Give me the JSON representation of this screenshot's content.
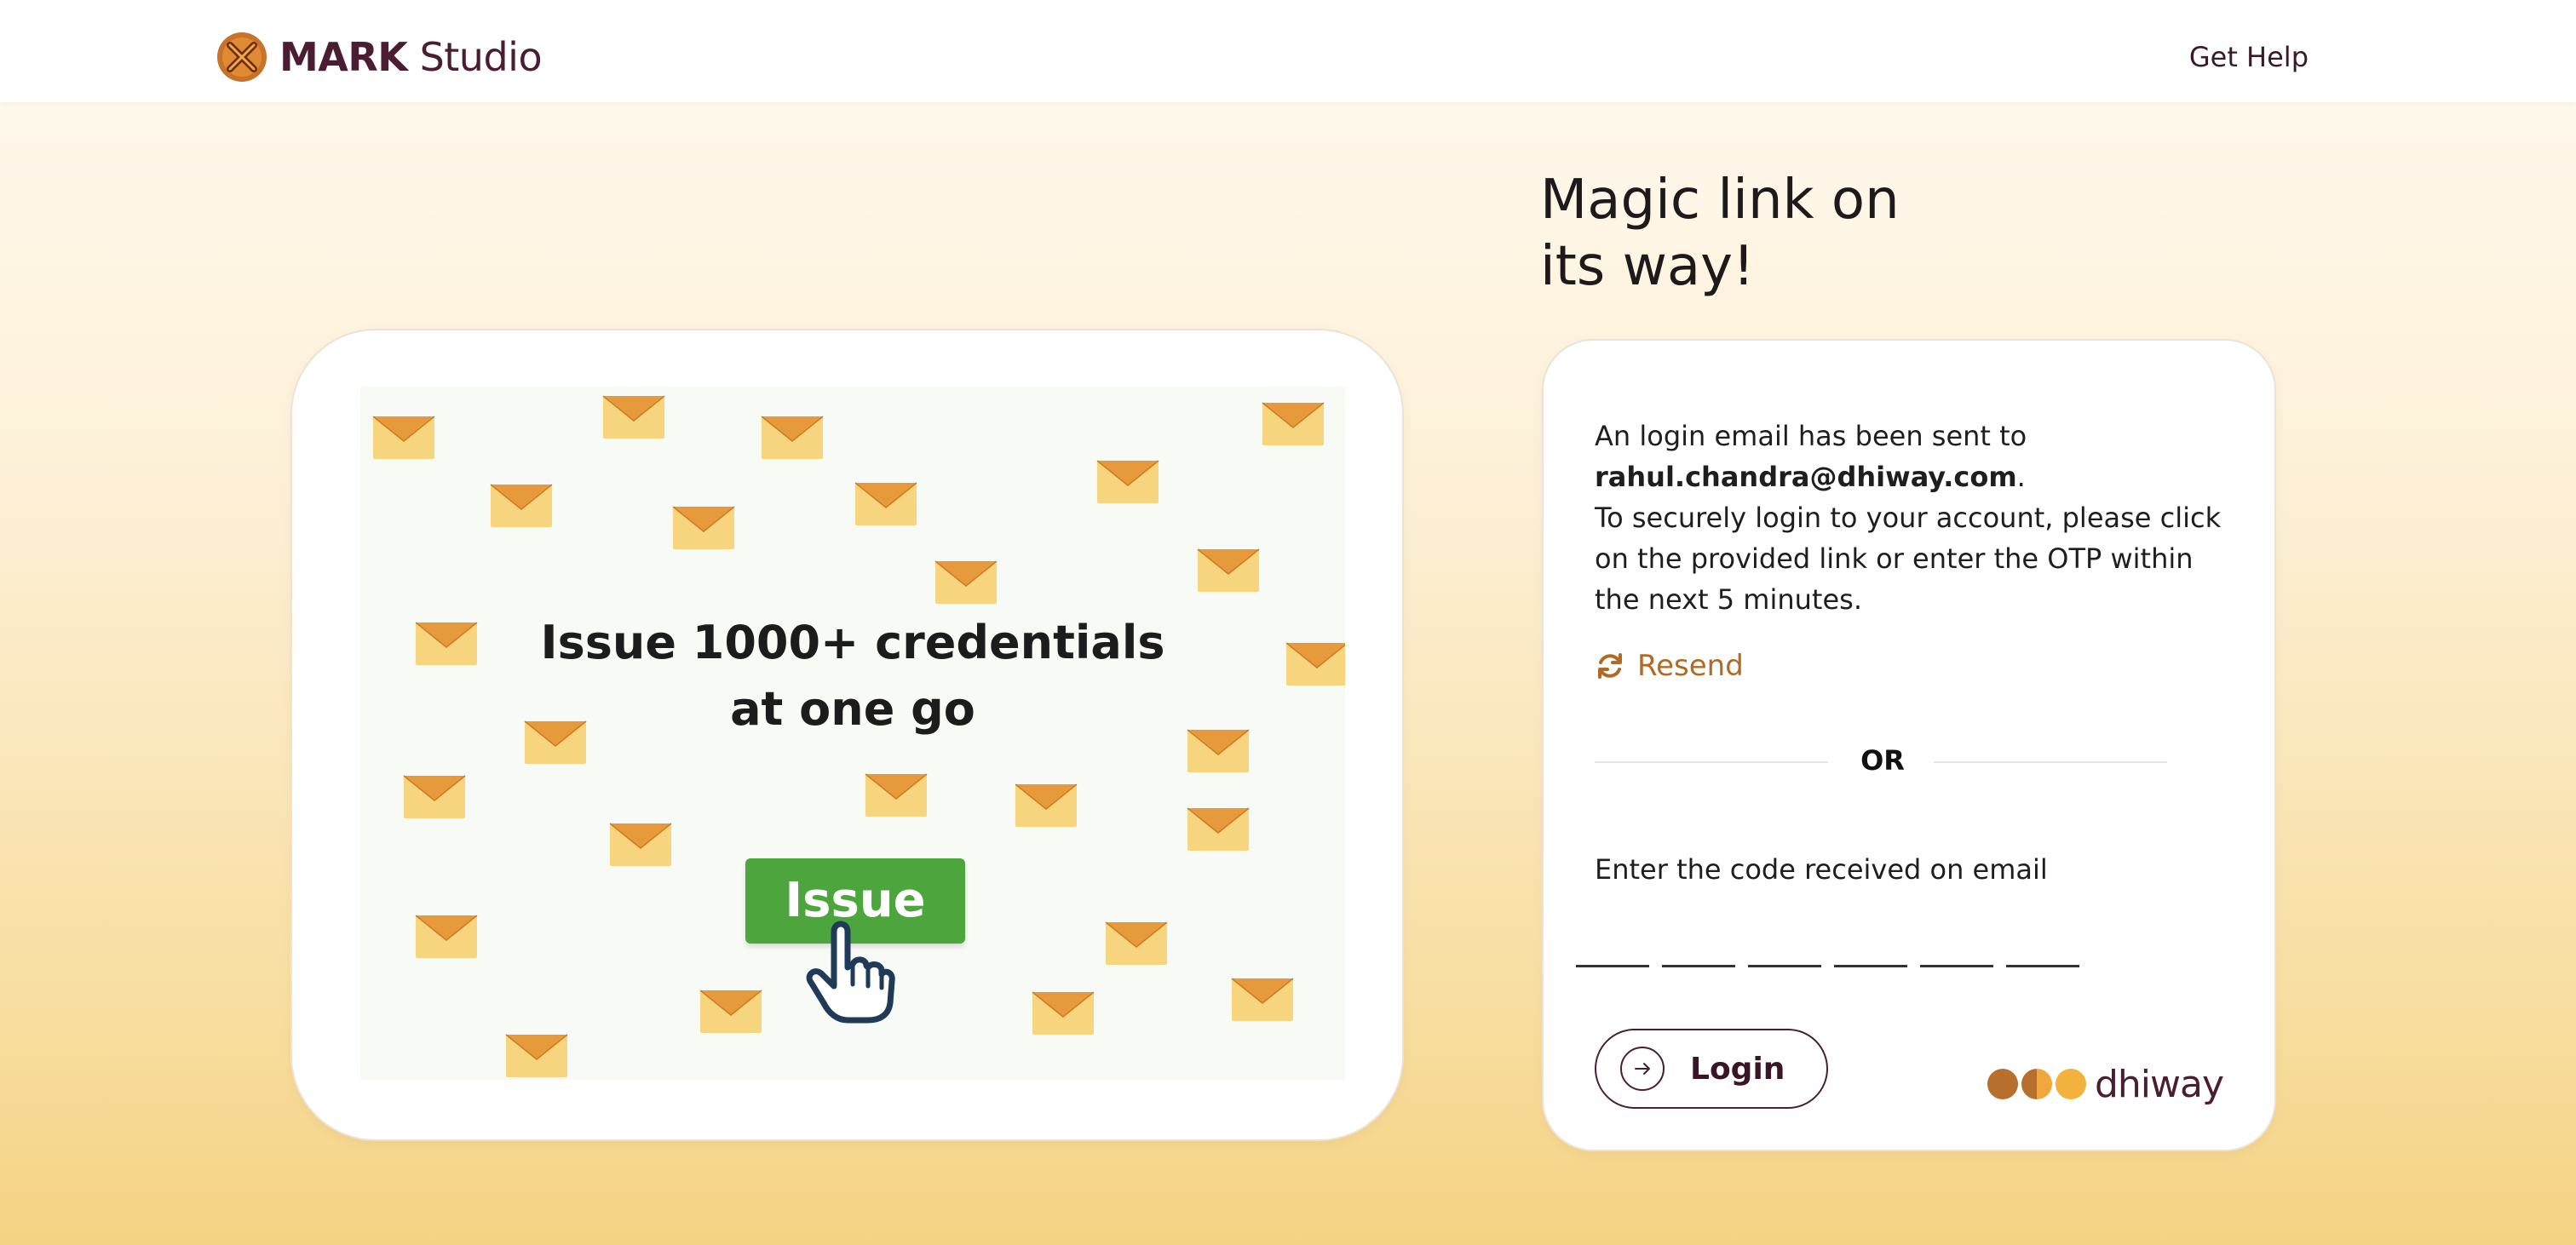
{
  "header": {
    "brand_bold": "MARK",
    "brand_light": " Studio",
    "help_link": "Get Help"
  },
  "promo": {
    "title_line1": "Issue 1000+ credentials",
    "title_line2": "at one go",
    "button_label": "Issue"
  },
  "right": {
    "title_line1": "Magic link on",
    "title_line2": "its way!"
  },
  "card": {
    "msg_line1": "An login email has been sent to",
    "email": "rahul.chandra@dhiway.com",
    "email_suffix": ".",
    "msg_line2": "To securely login to your account, please click on the provided link or enter the OTP within the next 5 minutes.",
    "resend_label": "Resend",
    "or_label": "OR",
    "code_label": "Enter the code received on email",
    "login_label": "Login",
    "brand_name": "dhiway"
  },
  "colors": {
    "accent_orange": "#b06a25",
    "issue_green": "#4ca53d",
    "brand_purple": "#4a1d33"
  }
}
